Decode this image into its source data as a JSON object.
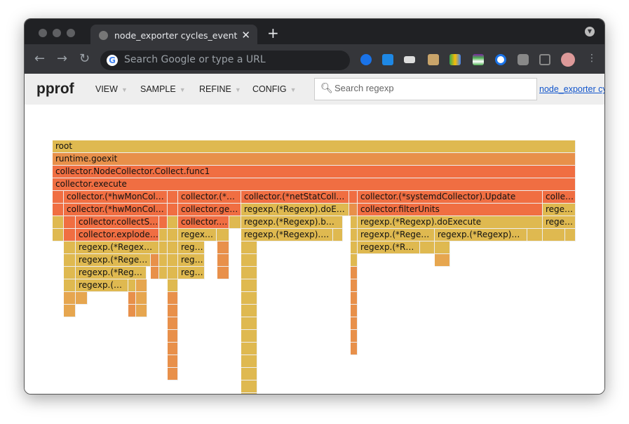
{
  "browser": {
    "tab_title": "node_exporter cycles_event",
    "omnibox_placeholder": "Search Google or type a URL"
  },
  "pprof": {
    "logo": "pprof",
    "menus": [
      {
        "label": "VIEW"
      },
      {
        "label": "SAMPLE"
      },
      {
        "label": "REFINE"
      },
      {
        "label": "CONFIG"
      }
    ],
    "search_placeholder": "Search regexp",
    "profile_link": "node_exporter cycles_event"
  },
  "colors": {
    "yellow": "#dfb950",
    "orange": "#e8904a",
    "red": "#f06e42",
    "amber": "#e6a64f"
  },
  "frames": [
    {
      "label": "root",
      "c": "yellow"
    },
    {
      "label": "runtime.goexit",
      "c": "orange"
    },
    {
      "label": "collector.NodeCollector.Collect.func1",
      "c": "red"
    },
    {
      "label": "collector.execute",
      "c": "red"
    },
    {
      "label": "",
      "c": "red"
    },
    {
      "label": "collector.(*hwMonCol…",
      "c": "red"
    },
    {
      "label": "",
      "c": "red"
    },
    {
      "label": "collector.(*…",
      "c": "red"
    },
    {
      "label": "collector.(*netStatColl…",
      "c": "red"
    },
    {
      "label": "",
      "c": "red"
    },
    {
      "label": "collector.(*systemdCollector).Update",
      "c": "red"
    },
    {
      "label": "colle…",
      "c": "red"
    },
    {
      "label": "",
      "c": "red"
    },
    {
      "label": "collector.(*hwMonCol…",
      "c": "red"
    },
    {
      "label": "",
      "c": "red"
    },
    {
      "label": "collector.ge…",
      "c": "red"
    },
    {
      "label": "regexp.(*Regexp).doE…",
      "c": "yellow"
    },
    {
      "label": "",
      "c": "orange"
    },
    {
      "label": "collector.filterUnits",
      "c": "red"
    },
    {
      "label": "rege…",
      "c": "yellow"
    },
    {
      "label": "",
      "c": "yellow"
    },
    {
      "label": "",
      "c": "red"
    },
    {
      "label": "collector.collectS…",
      "c": "red"
    },
    {
      "label": "",
      "c": "red"
    },
    {
      "label": "",
      "c": "yellow"
    },
    {
      "label": "collector.…",
      "c": "red"
    },
    {
      "label": "",
      "c": "yellow"
    },
    {
      "label": "regexp.(*Regexp).b…",
      "c": "yellow"
    },
    {
      "label": "",
      "c": "yellow"
    },
    {
      "label": "regexp.(*Regexp).doExecute",
      "c": "yellow"
    },
    {
      "label": "rege…",
      "c": "yellow"
    },
    {
      "label": "",
      "c": "yellow"
    },
    {
      "label": "",
      "c": "red"
    },
    {
      "label": "collector.explode…",
      "c": "red"
    },
    {
      "label": "",
      "c": "yellow"
    },
    {
      "label": "",
      "c": "yellow"
    },
    {
      "label": "regex…",
      "c": "yellow"
    },
    {
      "label": "",
      "c": "yellow"
    },
    {
      "label": "regexp.(*Regexp).…",
      "c": "yellow"
    },
    {
      "label": "",
      "c": "yellow"
    },
    {
      "label": "",
      "c": "yellow"
    },
    {
      "label": "regexp.(*Rege…",
      "c": "yellow"
    },
    {
      "label": "regexp.(*Regexp)…",
      "c": "yellow"
    },
    {
      "label": "",
      "c": "yellow"
    },
    {
      "label": "",
      "c": "yellow"
    },
    {
      "label": "",
      "c": "yellow"
    },
    {
      "label": "",
      "c": "yellow"
    },
    {
      "label": "regexp.(*Regex…",
      "c": "yellow"
    },
    {
      "label": "",
      "c": "yellow"
    },
    {
      "label": "",
      "c": "yellow"
    },
    {
      "label": "reg…",
      "c": "yellow"
    },
    {
      "label": "",
      "c": "orange"
    },
    {
      "label": "",
      "c": "yellow"
    },
    {
      "label": "",
      "c": "yellow"
    },
    {
      "label": "regexp.(*R…",
      "c": "yellow"
    },
    {
      "label": "",
      "c": "yellow"
    },
    {
      "label": "",
      "c": "yellow"
    },
    {
      "label": "",
      "c": "yellow"
    },
    {
      "label": "regexp.(*Rege…",
      "c": "yellow"
    },
    {
      "label": "",
      "c": "orange"
    },
    {
      "label": "",
      "c": "yellow"
    },
    {
      "label": "",
      "c": "yellow"
    },
    {
      "label": "reg…",
      "c": "yellow"
    },
    {
      "label": "",
      "c": "orange"
    },
    {
      "label": "",
      "c": "yellow"
    },
    {
      "label": "",
      "c": "yellow"
    },
    {
      "label": "",
      "c": "amber"
    },
    {
      "label": "",
      "c": "yellow"
    },
    {
      "label": "regexp.(*Reg…",
      "c": "yellow"
    },
    {
      "label": "",
      "c": "orange"
    },
    {
      "label": "",
      "c": "yellow"
    },
    {
      "label": "",
      "c": "yellow"
    },
    {
      "label": "reg…",
      "c": "yellow"
    },
    {
      "label": "",
      "c": "orange"
    },
    {
      "label": "",
      "c": "yellow"
    },
    {
      "label": "",
      "c": "orange"
    },
    {
      "label": "",
      "c": "yellow"
    },
    {
      "label": "regexp.(…",
      "c": "yellow"
    },
    {
      "label": "",
      "c": "yellow"
    },
    {
      "label": "",
      "c": "amber"
    },
    {
      "label": "",
      "c": "yellow"
    },
    {
      "label": "",
      "c": "yellow"
    },
    {
      "label": "",
      "c": "orange"
    },
    {
      "label": "",
      "c": "amber"
    },
    {
      "label": "",
      "c": "amber"
    },
    {
      "label": "",
      "c": "orange"
    },
    {
      "label": "",
      "c": "amber"
    },
    {
      "label": "",
      "c": "orange"
    },
    {
      "label": "",
      "c": "yellow"
    },
    {
      "label": "",
      "c": "orange"
    },
    {
      "label": "",
      "c": "amber"
    },
    {
      "label": "",
      "c": "orange"
    },
    {
      "label": "",
      "c": "amber"
    },
    {
      "label": "",
      "c": "orange"
    },
    {
      "label": "",
      "c": "yellow"
    },
    {
      "label": "",
      "c": "orange"
    }
  ]
}
